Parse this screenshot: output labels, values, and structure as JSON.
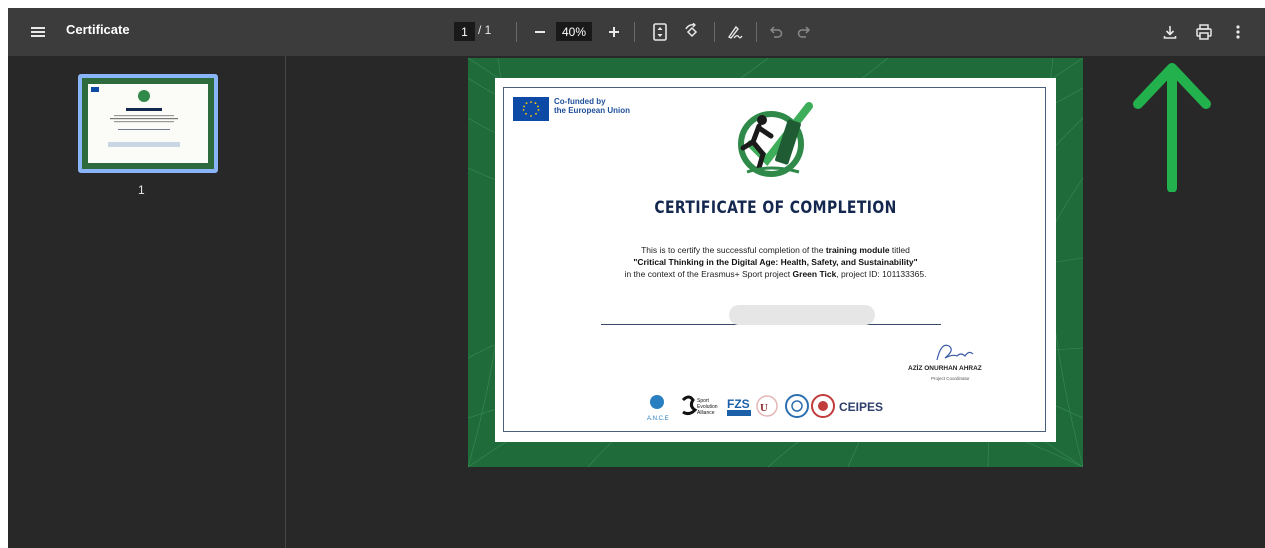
{
  "toolbar": {
    "title": "Certificate",
    "page_current": "1",
    "page_total": "/ 1",
    "zoom_value": "40%"
  },
  "sidebar": {
    "thumbnails": [
      {
        "page_number": "1",
        "selected": true
      }
    ]
  },
  "certificate": {
    "eu_line1": "Co-funded by",
    "eu_line2": "the European Union",
    "title": "CERTIFICATE OF COMPLETION",
    "body_line1_pre": "This is to certify the successful completion of the ",
    "body_line1_bold": "training module",
    "body_line1_post": " titled",
    "body_line2": "\"Critical Thinking in the Digital Age: Health, Safety, and Sustainability\"",
    "body_line3_pre": "in the context of the Erasmus+ Sport project ",
    "body_line3_bold": "Green Tick",
    "body_line3_post": ", project  ID: 101133365.",
    "signatory_name": "AZİZ ONURHAN AHRAZ",
    "signatory_role": "Project Coordinator",
    "partner_logos": [
      "A.N.C.E",
      "Sport Evolution Alliance",
      "FZS",
      "CEIPES"
    ]
  },
  "colors": {
    "toolbar_bg": "#3c3c3c",
    "viewer_bg": "#282828",
    "thumb_selected_border": "#8ab4f8",
    "cert_green": "#1f6b3a",
    "annotation_arrow": "#22b14c"
  },
  "icons": {
    "menu": "hamburger-menu-icon",
    "zoom_out": "minus-icon",
    "zoom_in": "plus-icon",
    "fit": "fit-to-page-icon",
    "rotate": "rotate-icon",
    "annotate": "pen-icon",
    "undo": "undo-icon",
    "redo": "redo-icon",
    "download": "download-icon",
    "print": "print-icon",
    "more": "more-vert-icon"
  }
}
